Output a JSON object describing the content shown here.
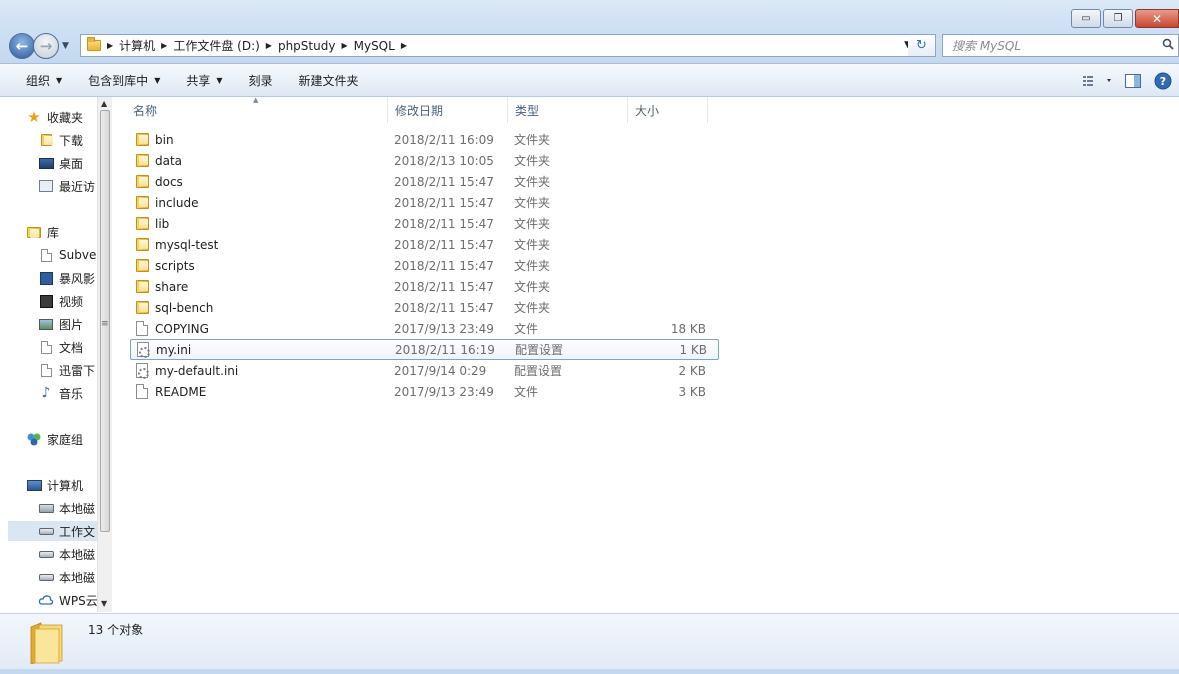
{
  "window": {
    "minimize_label": "▭",
    "restore_label": "❐",
    "close_label": "✕"
  },
  "address": {
    "crumbs": [
      "计算机",
      "工作文件盘 (D:)",
      "phpStudy",
      "MySQL"
    ]
  },
  "search": {
    "placeholder": "搜索 MySQL"
  },
  "toolbar": {
    "organize": "组织",
    "include_in_library": "包含到库中",
    "share": "共享",
    "burn": "刻录",
    "new_folder": "新建文件夹"
  },
  "sidebar": {
    "favorites": "收藏夹",
    "favorites_items": [
      "下载",
      "桌面",
      "最近访"
    ],
    "libraries": "库",
    "libraries_items": [
      "Subver",
      "暴风影",
      "视频",
      "图片",
      "文档",
      "迅雷下",
      "音乐"
    ],
    "homegroup": "家庭组",
    "computer": "计算机",
    "computer_items": [
      "本地磁",
      "工作文",
      "本地磁",
      "本地磁",
      "WPS云"
    ]
  },
  "columns": {
    "name": "名称",
    "modified": "修改日期",
    "type": "类型",
    "size": "大小"
  },
  "files": [
    {
      "name": "bin",
      "date": "2018/2/11 16:09",
      "type": "文件夹",
      "size": "",
      "icon": "folder-icon"
    },
    {
      "name": "data",
      "date": "2018/2/13 10:05",
      "type": "文件夹",
      "size": "",
      "icon": "folder-icon"
    },
    {
      "name": "docs",
      "date": "2018/2/11 15:47",
      "type": "文件夹",
      "size": "",
      "icon": "folder-icon"
    },
    {
      "name": "include",
      "date": "2018/2/11 15:47",
      "type": "文件夹",
      "size": "",
      "icon": "folder-icon"
    },
    {
      "name": "lib",
      "date": "2018/2/11 15:47",
      "type": "文件夹",
      "size": "",
      "icon": "folder-icon"
    },
    {
      "name": "mysql-test",
      "date": "2018/2/11 15:47",
      "type": "文件夹",
      "size": "",
      "icon": "folder-icon"
    },
    {
      "name": "scripts",
      "date": "2018/2/11 15:47",
      "type": "文件夹",
      "size": "",
      "icon": "folder-icon"
    },
    {
      "name": "share",
      "date": "2018/2/11 15:47",
      "type": "文件夹",
      "size": "",
      "icon": "folder-icon"
    },
    {
      "name": "sql-bench",
      "date": "2018/2/11 15:47",
      "type": "文件夹",
      "size": "",
      "icon": "folder-icon"
    },
    {
      "name": "COPYING",
      "date": "2017/9/13 23:49",
      "type": "文件",
      "size": "18 KB",
      "icon": "file-icon"
    },
    {
      "name": "my.ini",
      "date": "2018/2/11 16:19",
      "type": "配置设置",
      "size": "1 KB",
      "icon": "config-file-icon",
      "selected": true
    },
    {
      "name": "my-default.ini",
      "date": "2017/9/14 0:29",
      "type": "配置设置",
      "size": "2 KB",
      "icon": "config-file-icon"
    },
    {
      "name": "README",
      "date": "2017/9/13 23:49",
      "type": "文件",
      "size": "3 KB",
      "icon": "file-icon"
    }
  ],
  "status": {
    "count": "13 个对象"
  }
}
